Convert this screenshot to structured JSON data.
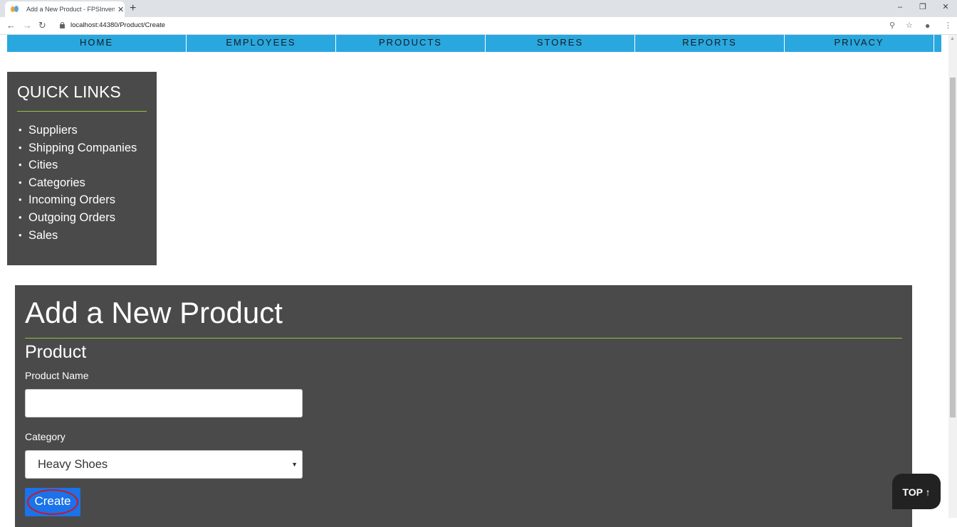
{
  "browser": {
    "tab_title": "Add a New Product - FPSInvento",
    "tab_close": "✕",
    "new_tab": "+",
    "url": "localhost:44380/Product/Create",
    "window_controls": [
      "–",
      "❐",
      "✕"
    ],
    "nav_icons": [
      "back-icon",
      "forward-icon",
      "reload-icon"
    ],
    "right_icons": [
      "zoom-icon",
      "star-icon",
      "account-icon",
      "menu-icon"
    ]
  },
  "nav": {
    "items": [
      "HOME",
      "EMPLOYEES",
      "PRODUCTS",
      "STORES",
      "REPORTS",
      "PRIVACY"
    ]
  },
  "quick_links": {
    "title": "QUICK LINKS",
    "items": [
      "Suppliers",
      "Shipping Companies",
      "Cities",
      "Categories",
      "Incoming Orders",
      "Outgoing Orders",
      "Sales"
    ]
  },
  "form": {
    "title": "Add a New Product",
    "section": "Product",
    "product_name_label": "Product Name",
    "product_name_value": "",
    "category_label": "Category",
    "category_selected": "Heavy Shoes",
    "create_label": "Create"
  },
  "top_button": "TOP ↑",
  "colors": {
    "nav_bg": "#29a7df",
    "panel_bg": "#4a4a4a",
    "accent_rule": "#8cc63f",
    "button_bg": "#1a73e8",
    "highlight_ring": "#d6121e"
  }
}
